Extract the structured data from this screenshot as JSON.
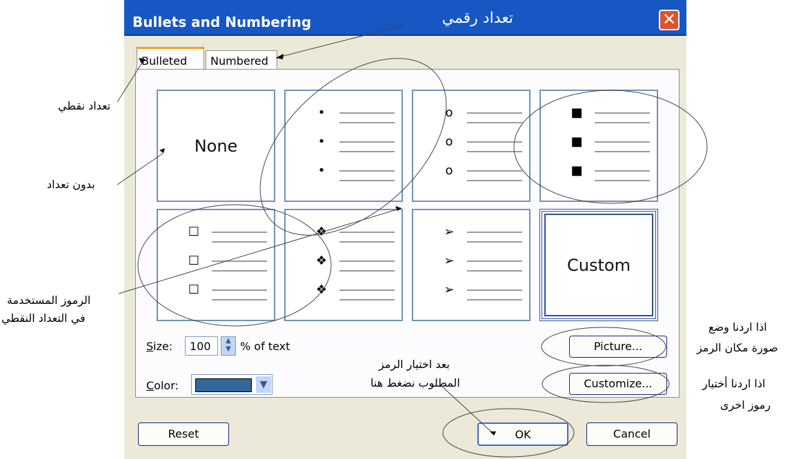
{
  "dialog": {
    "title": "Bullets and Numbering",
    "close_glyph": "✕"
  },
  "tabs": [
    {
      "label": "Bulleted",
      "active": true
    },
    {
      "label": "Numbered",
      "active": false
    }
  ],
  "gallery": {
    "none_label": "None",
    "custom_label": "Custom",
    "bullet_styles": [
      {
        "name": "dot",
        "glyph": "•"
      },
      {
        "name": "circle",
        "glyph": "o"
      },
      {
        "name": "square",
        "glyph": "■"
      },
      {
        "name": "hollow-square",
        "glyph": "☐"
      },
      {
        "name": "four-diamond",
        "glyph": "❖"
      },
      {
        "name": "arrowhead",
        "glyph": "➢"
      }
    ]
  },
  "size": {
    "label_prefix": "S",
    "label_rest": "ize:",
    "value": "100",
    "suffix": "% of text"
  },
  "color": {
    "label_prefix": "C",
    "label_rest": "olor:",
    "swatch": "#336699"
  },
  "buttons": {
    "picture": "Picture...",
    "customize": "Customize...",
    "reset": "Reset",
    "ok": "OK",
    "cancel": "Cancel"
  },
  "annotations": {
    "numbered_tab": "تعداد رقمي",
    "bulleted_tab": "تعداد نقطي",
    "no_bullets": "بدون تعداد",
    "symbols_line1": "الرموز المستخدمة",
    "symbols_line2": "في التعداد النقطي",
    "after_select_line1": "بعد اختيار الرمز",
    "after_select_line2": "المطلوب نضغط هنا",
    "picture_line1": "اذا اردنا وضع",
    "picture_line2": "صورة مكان الرمز",
    "customize_line1": "اذا اردنا أختيار",
    "customize_line2": "رموز اخرى"
  }
}
